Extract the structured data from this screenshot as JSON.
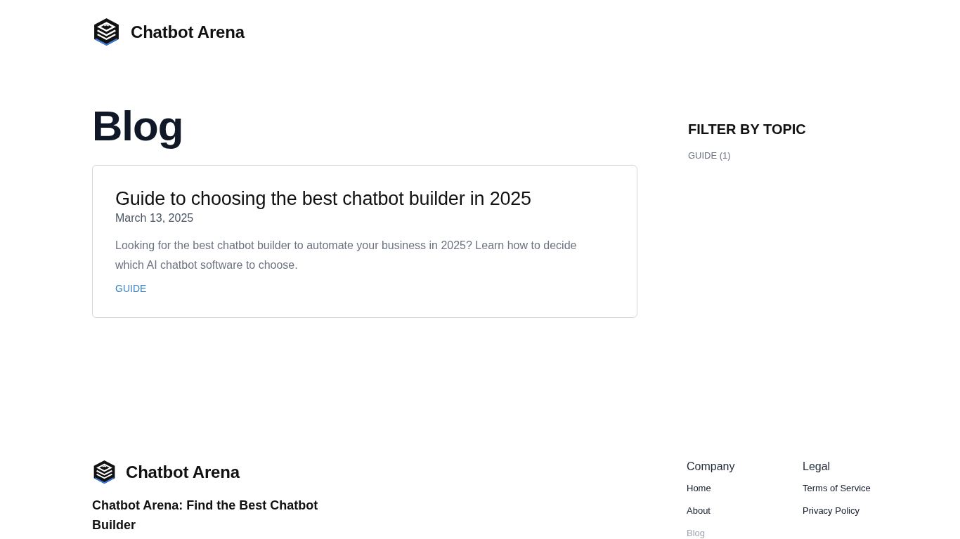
{
  "header": {
    "logo_text": "Chatbot Arena"
  },
  "page_title": "Blog",
  "posts": [
    {
      "title": "Guide to choosing the best chatbot builder in 2025",
      "date": "March 13, 2025",
      "excerpt": "Looking for the best chatbot builder to automate your business in 2025? Learn how to decide which AI chatbot software to choose.",
      "tags": [
        "GUIDE"
      ]
    }
  ],
  "sidebar": {
    "heading": "FILTER BY TOPIC",
    "topics": [
      {
        "label": "GUIDE (1)"
      }
    ]
  },
  "footer": {
    "logo_text": "Chatbot Arena",
    "tagline": "Chatbot Arena: Find the Best Chatbot Builder",
    "columns": [
      {
        "heading": "Company",
        "links": [
          {
            "label": "Home",
            "selected": false
          },
          {
            "label": "About",
            "selected": false
          },
          {
            "label": "Blog",
            "selected": true
          }
        ]
      },
      {
        "heading": "Legal",
        "links": [
          {
            "label": "Terms of Service",
            "selected": false
          },
          {
            "label": "Privacy Policy",
            "selected": false
          }
        ]
      }
    ]
  }
}
